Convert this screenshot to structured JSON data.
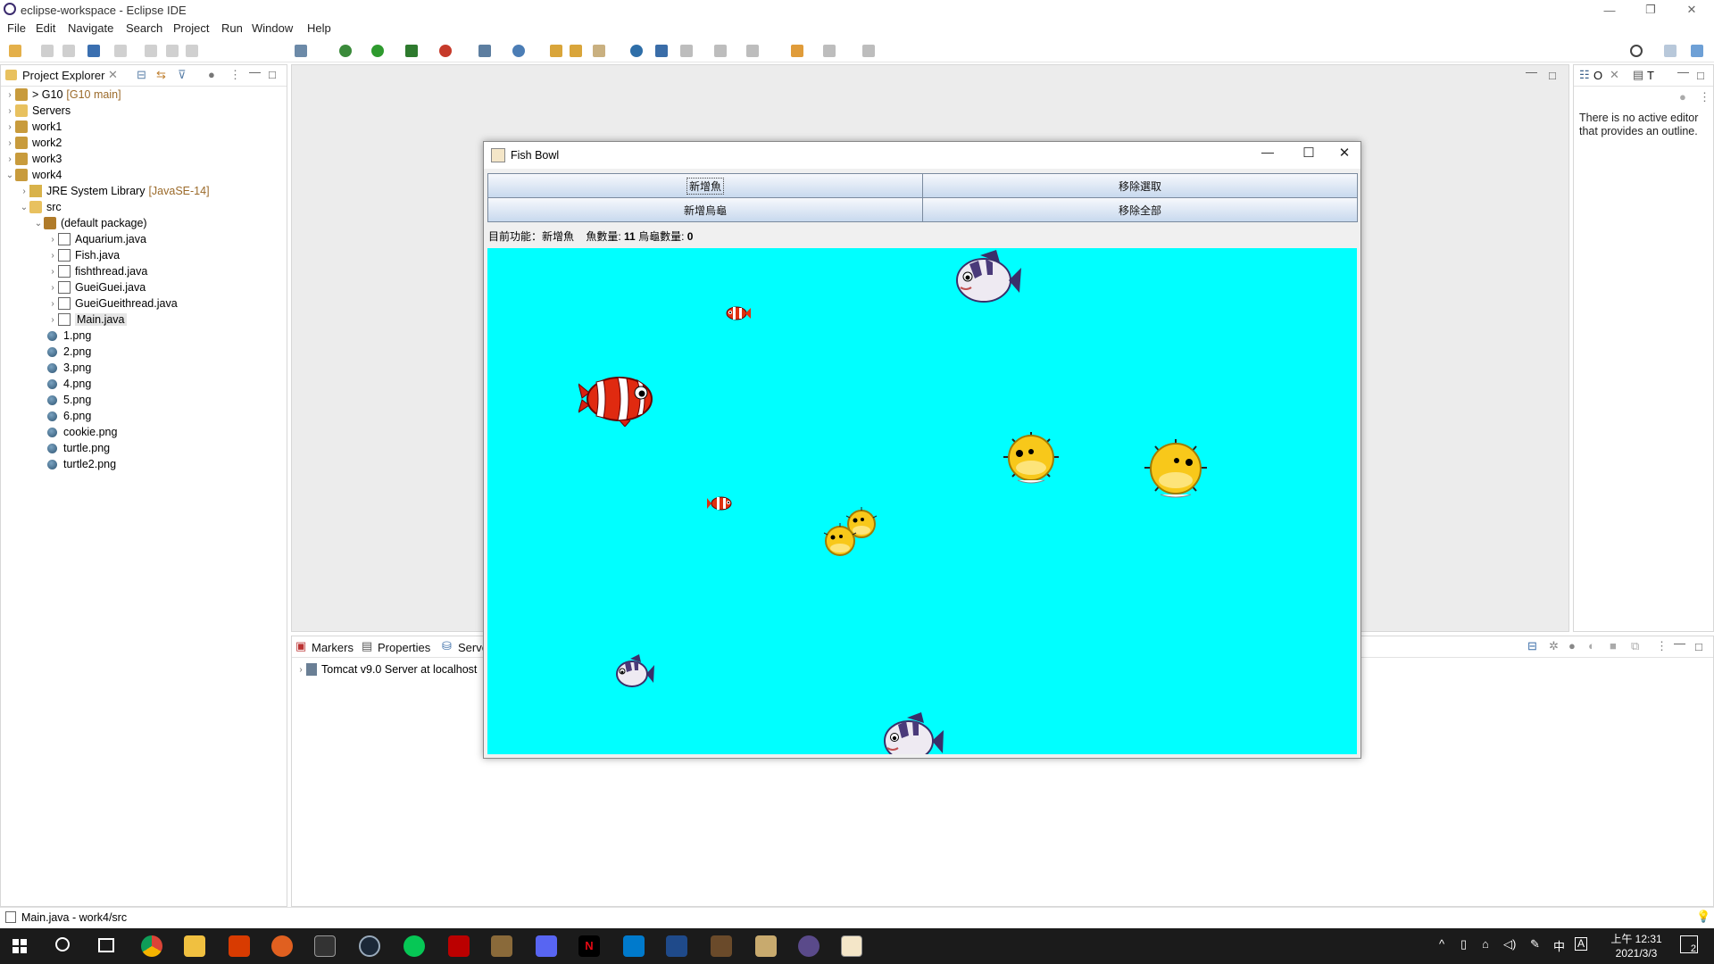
{
  "window": {
    "title": "eclipse-workspace - Eclipse IDE",
    "minimize": "—",
    "restore": "❐",
    "close": "✕"
  },
  "menu": [
    "File",
    "Edit",
    "Navigate",
    "Search",
    "Project",
    "Run",
    "Window",
    "Help"
  ],
  "project_explorer": {
    "tab_label": "Project Explorer",
    "items": [
      {
        "label": "> G10",
        "suffix": "[G10 main]"
      },
      {
        "label": "Servers"
      },
      {
        "label": "work1"
      },
      {
        "label": "work2"
      },
      {
        "label": "work3"
      },
      {
        "label": "work4"
      },
      {
        "label": "JRE System Library",
        "suffix": "[JavaSE-14]"
      },
      {
        "label": "src"
      },
      {
        "label": "(default package)"
      },
      {
        "label": "Aquarium.java"
      },
      {
        "label": "Fish.java"
      },
      {
        "label": "fishthread.java"
      },
      {
        "label": "GueiGuei.java"
      },
      {
        "label": "GueiGueithread.java"
      },
      {
        "label": "Main.java"
      },
      {
        "label": "1.png"
      },
      {
        "label": "2.png"
      },
      {
        "label": "3.png"
      },
      {
        "label": "4.png"
      },
      {
        "label": "5.png"
      },
      {
        "label": "6.png"
      },
      {
        "label": "cookie.png"
      },
      {
        "label": "turtle.png"
      },
      {
        "label": "turtle2.png"
      }
    ]
  },
  "outline": {
    "tab_o": "O",
    "tab_t": "T",
    "message": "There is no active editor that provides an outline."
  },
  "bottom_panel": {
    "tabs": [
      "Markers",
      "Properties",
      "Serve"
    ],
    "server_row": "Tomcat v9.0 Server at localhost"
  },
  "fishbowl": {
    "title": "Fish Bowl",
    "buttons": {
      "add_fish": "新增魚",
      "remove_selected": "移除選取",
      "add_turtle": "新增烏龜",
      "remove_all": "移除全部"
    },
    "status": {
      "function_label": "目前功能：新增魚",
      "fish_count_label": "魚數量:",
      "fish_count": "11",
      "turtle_count_label": "烏龜數量:",
      "turtle_count": "0"
    },
    "bowl_color": "#00ffff"
  },
  "status_bar": {
    "text": "Main.java - work4/src"
  },
  "taskbar": {
    "time": "上午 12:31",
    "date": "2021/3/3",
    "ime": "中",
    "ime2": "A",
    "notif_count": "2"
  }
}
